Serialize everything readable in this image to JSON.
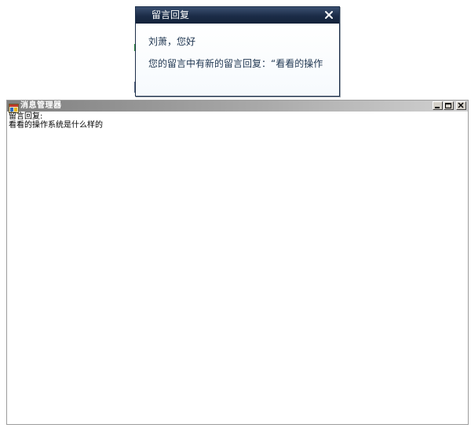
{
  "popup": {
    "title": "留言回复",
    "close_icon": "close-x-icon",
    "greeting": "刘萧，您好",
    "message": "您的留言中有新的留言回复：“看看的操作"
  },
  "window": {
    "title": "消息管理器",
    "app_icon": "app-window-icon",
    "controls": {
      "minimize_icon": "minimize-icon",
      "maximize_icon": "maximize-icon",
      "close_icon": "close-icon"
    },
    "content": {
      "label": "留言回复:",
      "text": "看看的操作系统是什么样的"
    }
  },
  "colors": {
    "popup_titlebar": "#1b2c47",
    "popup_text": "#1e3550",
    "window_titlebar_start": "#808080",
    "window_titlebar_end": "#d2d2d2"
  }
}
